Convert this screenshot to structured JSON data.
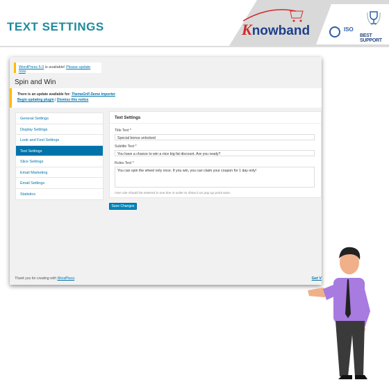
{
  "page_title": "TEXT SETTINGS",
  "brand": {
    "logo": "Knowband",
    "iso": "ISO",
    "best_support": "BEST SUPPORT",
    "accent": "#1f8a9c"
  },
  "wp": {
    "notice1": {
      "link1": "WordPress 5.0",
      "text": " is available! ",
      "link2": "Please update now",
      "end": "."
    },
    "heading": "Spin and Win",
    "notice2": {
      "text": "There is an update available for: ",
      "plugin": "ThemeGrill Demo Importer",
      "end": ".",
      "link1": "Begin updating plugin",
      "sep": " | ",
      "link2": "Dismiss this notice"
    },
    "sidebar": [
      {
        "label": "General Settings"
      },
      {
        "label": "Display Settings"
      },
      {
        "label": "Look and Feel Settings"
      },
      {
        "label": "Text Settings",
        "active": true
      },
      {
        "label": "Slice Settings"
      },
      {
        "label": "Email Marketing"
      },
      {
        "label": "Email Settings"
      },
      {
        "label": "Statistics"
      }
    ],
    "panel": {
      "title": "Text Settings",
      "title_label": "Title Text *",
      "title_value": "Special bonus unlocked",
      "subtitle_label": "Subtitle Text *",
      "subtitle_value": "You have a chance to win a nice big fat discount. Are you ready?",
      "rules_label": "Rules Text *",
      "rules_value": "You can spin the wheel only once. If you win, you can claim your coupon for 1 day only!",
      "hint": "One rule should be entered in one line in order to show it on pop up point wise."
    },
    "save": "Save Changes",
    "footer": {
      "text": "Thank you for creating with ",
      "link": "WordPress",
      "end": ".",
      "version": "Get V"
    }
  }
}
